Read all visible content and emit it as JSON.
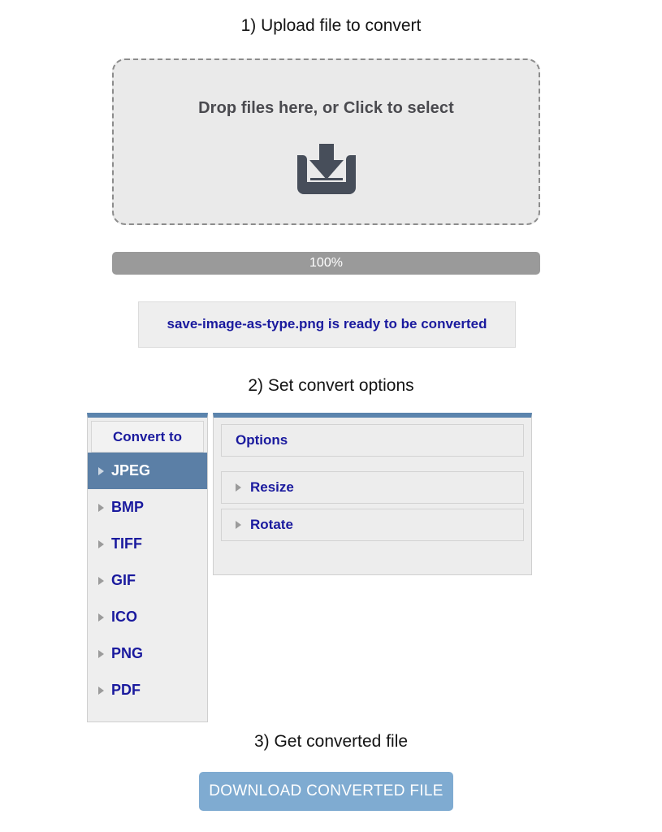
{
  "steps": {
    "step1": "1) Upload file to convert",
    "step2": "2) Set convert options",
    "step3": "3) Get converted file"
  },
  "dropzone": {
    "label": "Drop files here, or Click to select",
    "icon": "download-tray-icon"
  },
  "progress": {
    "label": "100%",
    "percent": 100,
    "bar_color": "#9a9a9a"
  },
  "status": {
    "message": "save-image-as-type.png is ready to be converted",
    "filename": "save-image-as-type.png",
    "text_color": "#1a1a9e"
  },
  "convert_to": {
    "header": "Convert to",
    "selected": "JPEG",
    "accent_color": "#5b84ad",
    "selected_bg": "#5b7fa6",
    "items": [
      {
        "label": "JPEG",
        "selected": true
      },
      {
        "label": "BMP",
        "selected": false
      },
      {
        "label": "TIFF",
        "selected": false
      },
      {
        "label": "GIF",
        "selected": false
      },
      {
        "label": "ICO",
        "selected": false
      },
      {
        "label": "PNG",
        "selected": false
      },
      {
        "label": "PDF",
        "selected": false
      }
    ]
  },
  "options": {
    "header": "Options",
    "rows": [
      {
        "label": "Resize",
        "expanded": false
      },
      {
        "label": "Rotate",
        "expanded": false
      }
    ]
  },
  "download": {
    "label": "DOWNLOAD CONVERTED FILE",
    "color": "#7fabd1"
  }
}
